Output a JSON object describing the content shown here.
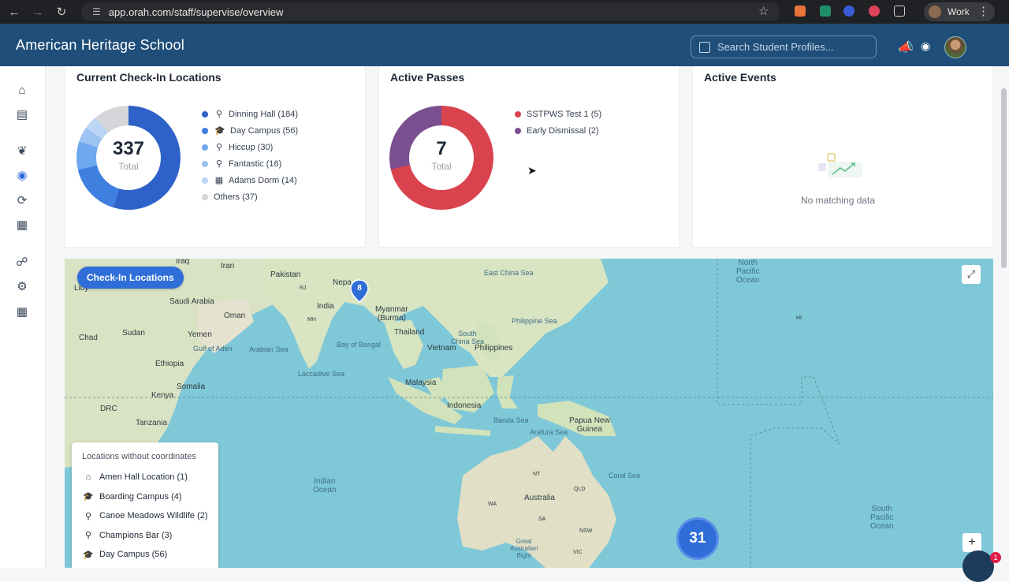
{
  "browser": {
    "url": "app.orah.com/staff/supervise/overview",
    "profile_label": "Work"
  },
  "header": {
    "school_name": "American Heritage School",
    "search_placeholder": "Search Student Profiles..."
  },
  "checkins": {
    "title": "Current Check-In Locations",
    "total": "337",
    "total_label": "Total",
    "items": [
      {
        "label": "Dinning Hall (184)",
        "icon": "map-pin-icon",
        "color": "#2f62c9"
      },
      {
        "label": "Day Campus (56)",
        "icon": "graduation-cap-icon",
        "color": "#3f7fe0"
      },
      {
        "label": "Hiccup (30)",
        "icon": "map-pin-icon",
        "color": "#6ea8ef"
      },
      {
        "label": "Fantastic (16)",
        "icon": "map-pin-icon",
        "color": "#9cc3f2"
      },
      {
        "label": "Adams Dorm (14)",
        "icon": "building-icon",
        "color": "#bdd5f5"
      },
      {
        "label": "Others (37)",
        "icon": "",
        "color": "#d4d6d9"
      }
    ],
    "chart_values": [
      184,
      56,
      30,
      16,
      14,
      37
    ]
  },
  "passes": {
    "title": "Active Passes",
    "total": "7",
    "total_label": "Total",
    "items": [
      {
        "label": "SSTPWS Test 1 (5)",
        "color": "#d9434e"
      },
      {
        "label": "Early Dismissal (2)",
        "color": "#7a4f8f"
      }
    ],
    "chart_values": [
      5,
      2
    ]
  },
  "events": {
    "title": "Active Events",
    "empty_text": "No matching data"
  },
  "map": {
    "pill_label": "Check-In Locations",
    "pin_count": "8",
    "cluster_count": "31",
    "labels": {
      "iraq": "Iraq",
      "iran": "Iran",
      "pakistan": "Pakistan",
      "nepal": "Nepa",
      "libya": "Liby",
      "saudi": "Saudi Arabia",
      "oman": "Oman",
      "india": "India",
      "myanmar": "Myanmar\n(Burma)",
      "thailand": "Thailand",
      "vietnam": "Vietnam",
      "philippines": "Philippines",
      "chad": "Chad",
      "sudan": "Sudan",
      "yemen": "Yemen",
      "ethiopia": "Ethiopia",
      "somalia": "Somalia",
      "kenya": "Kenya",
      "drc": "DRC",
      "tanzania": "Tanzania",
      "malaysia": "Malaysia",
      "indonesia": "Indonesia",
      "png": "Papua New\nGuinea",
      "australia": "Australia",
      "nt": "NT",
      "qld": "QLD",
      "wa": "WA",
      "sa": "SA",
      "nsw": "NSW",
      "vic": "VIC",
      "hi": "HI",
      "rj": "RJ",
      "mh": "MH"
    },
    "seas": {
      "east_china": "East China Sea",
      "philippine": "Philippine Sea",
      "south_china": "South\nChina Sea",
      "arabian": "Arabian Sea",
      "bengal": "Bay of Bengal",
      "laccadive": "Laccadive Sea",
      "gulf_aden": "Gulf of Aden",
      "banda": "Banda Sea",
      "arafura": "Arafura Sea",
      "coral": "Coral Sea",
      "indian": "Indian\nOcean",
      "north_pacific": "North\nPacific\nOcean",
      "south_pacific": "South\nPacific\nOcean",
      "great_bight": "Great\nAustralian\nBight"
    },
    "no_coords": {
      "title": "Locations without coordinates",
      "items": [
        {
          "label": "Amen Hall Location (1)",
          "icon": "home-icon"
        },
        {
          "label": "Boarding Campus (4)",
          "icon": "graduation-cap-icon"
        },
        {
          "label": "Canoe Meadows Wildlife (2)",
          "icon": "map-pin-icon"
        },
        {
          "label": "Champions Bar (3)",
          "icon": "map-pin-icon"
        },
        {
          "label": "Day Campus (56)",
          "icon": "graduation-cap-icon"
        }
      ]
    }
  },
  "notification_badge": "1"
}
